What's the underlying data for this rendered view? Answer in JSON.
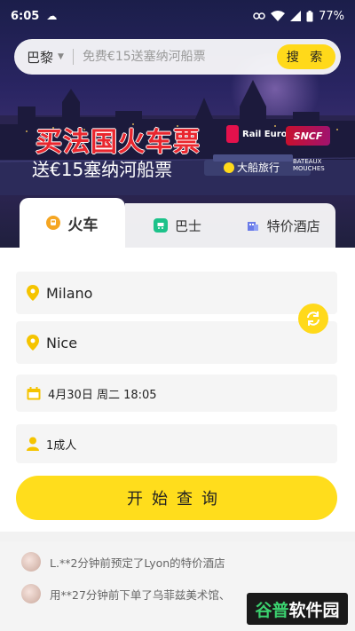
{
  "status_bar": {
    "time": "6:05",
    "battery": "77%"
  },
  "search": {
    "city": "巴黎",
    "placeholder": "免费€15送塞纳河船票",
    "button_label": "搜 索"
  },
  "banner": {
    "title_part1": "买法国",
    "title_part2": "火车票",
    "subtitle": "送€15塞纳河船票",
    "logos": {
      "rail_europe": "Rail Europe",
      "sncf": "SNCF",
      "dachuan": "大船旅行",
      "bateaux": "BATEAUX MOUCHES"
    }
  },
  "tabs": [
    {
      "label": "火车",
      "icon": "train-icon",
      "active": true
    },
    {
      "label": "巴士",
      "icon": "bus-icon",
      "active": false
    },
    {
      "label": "特价酒店",
      "icon": "hotel-icon",
      "active": false
    }
  ],
  "form": {
    "from": "Milano",
    "to": "Nice",
    "date": "4月30日 周二 18:05",
    "passengers": "1成人",
    "submit_label": "开始查询"
  },
  "feed": [
    {
      "text": "L.**2分钟前预定了Lyon的特价酒店"
    },
    {
      "text": "用**27分钟前下单了乌菲兹美术馆、"
    }
  ],
  "watermark": {
    "text": "谷普软件园"
  },
  "colors": {
    "accent": "#ffd91a",
    "brand_red": "#e9262e",
    "bus_green": "#1cc28a",
    "hotel_blue": "#6a7be8"
  }
}
